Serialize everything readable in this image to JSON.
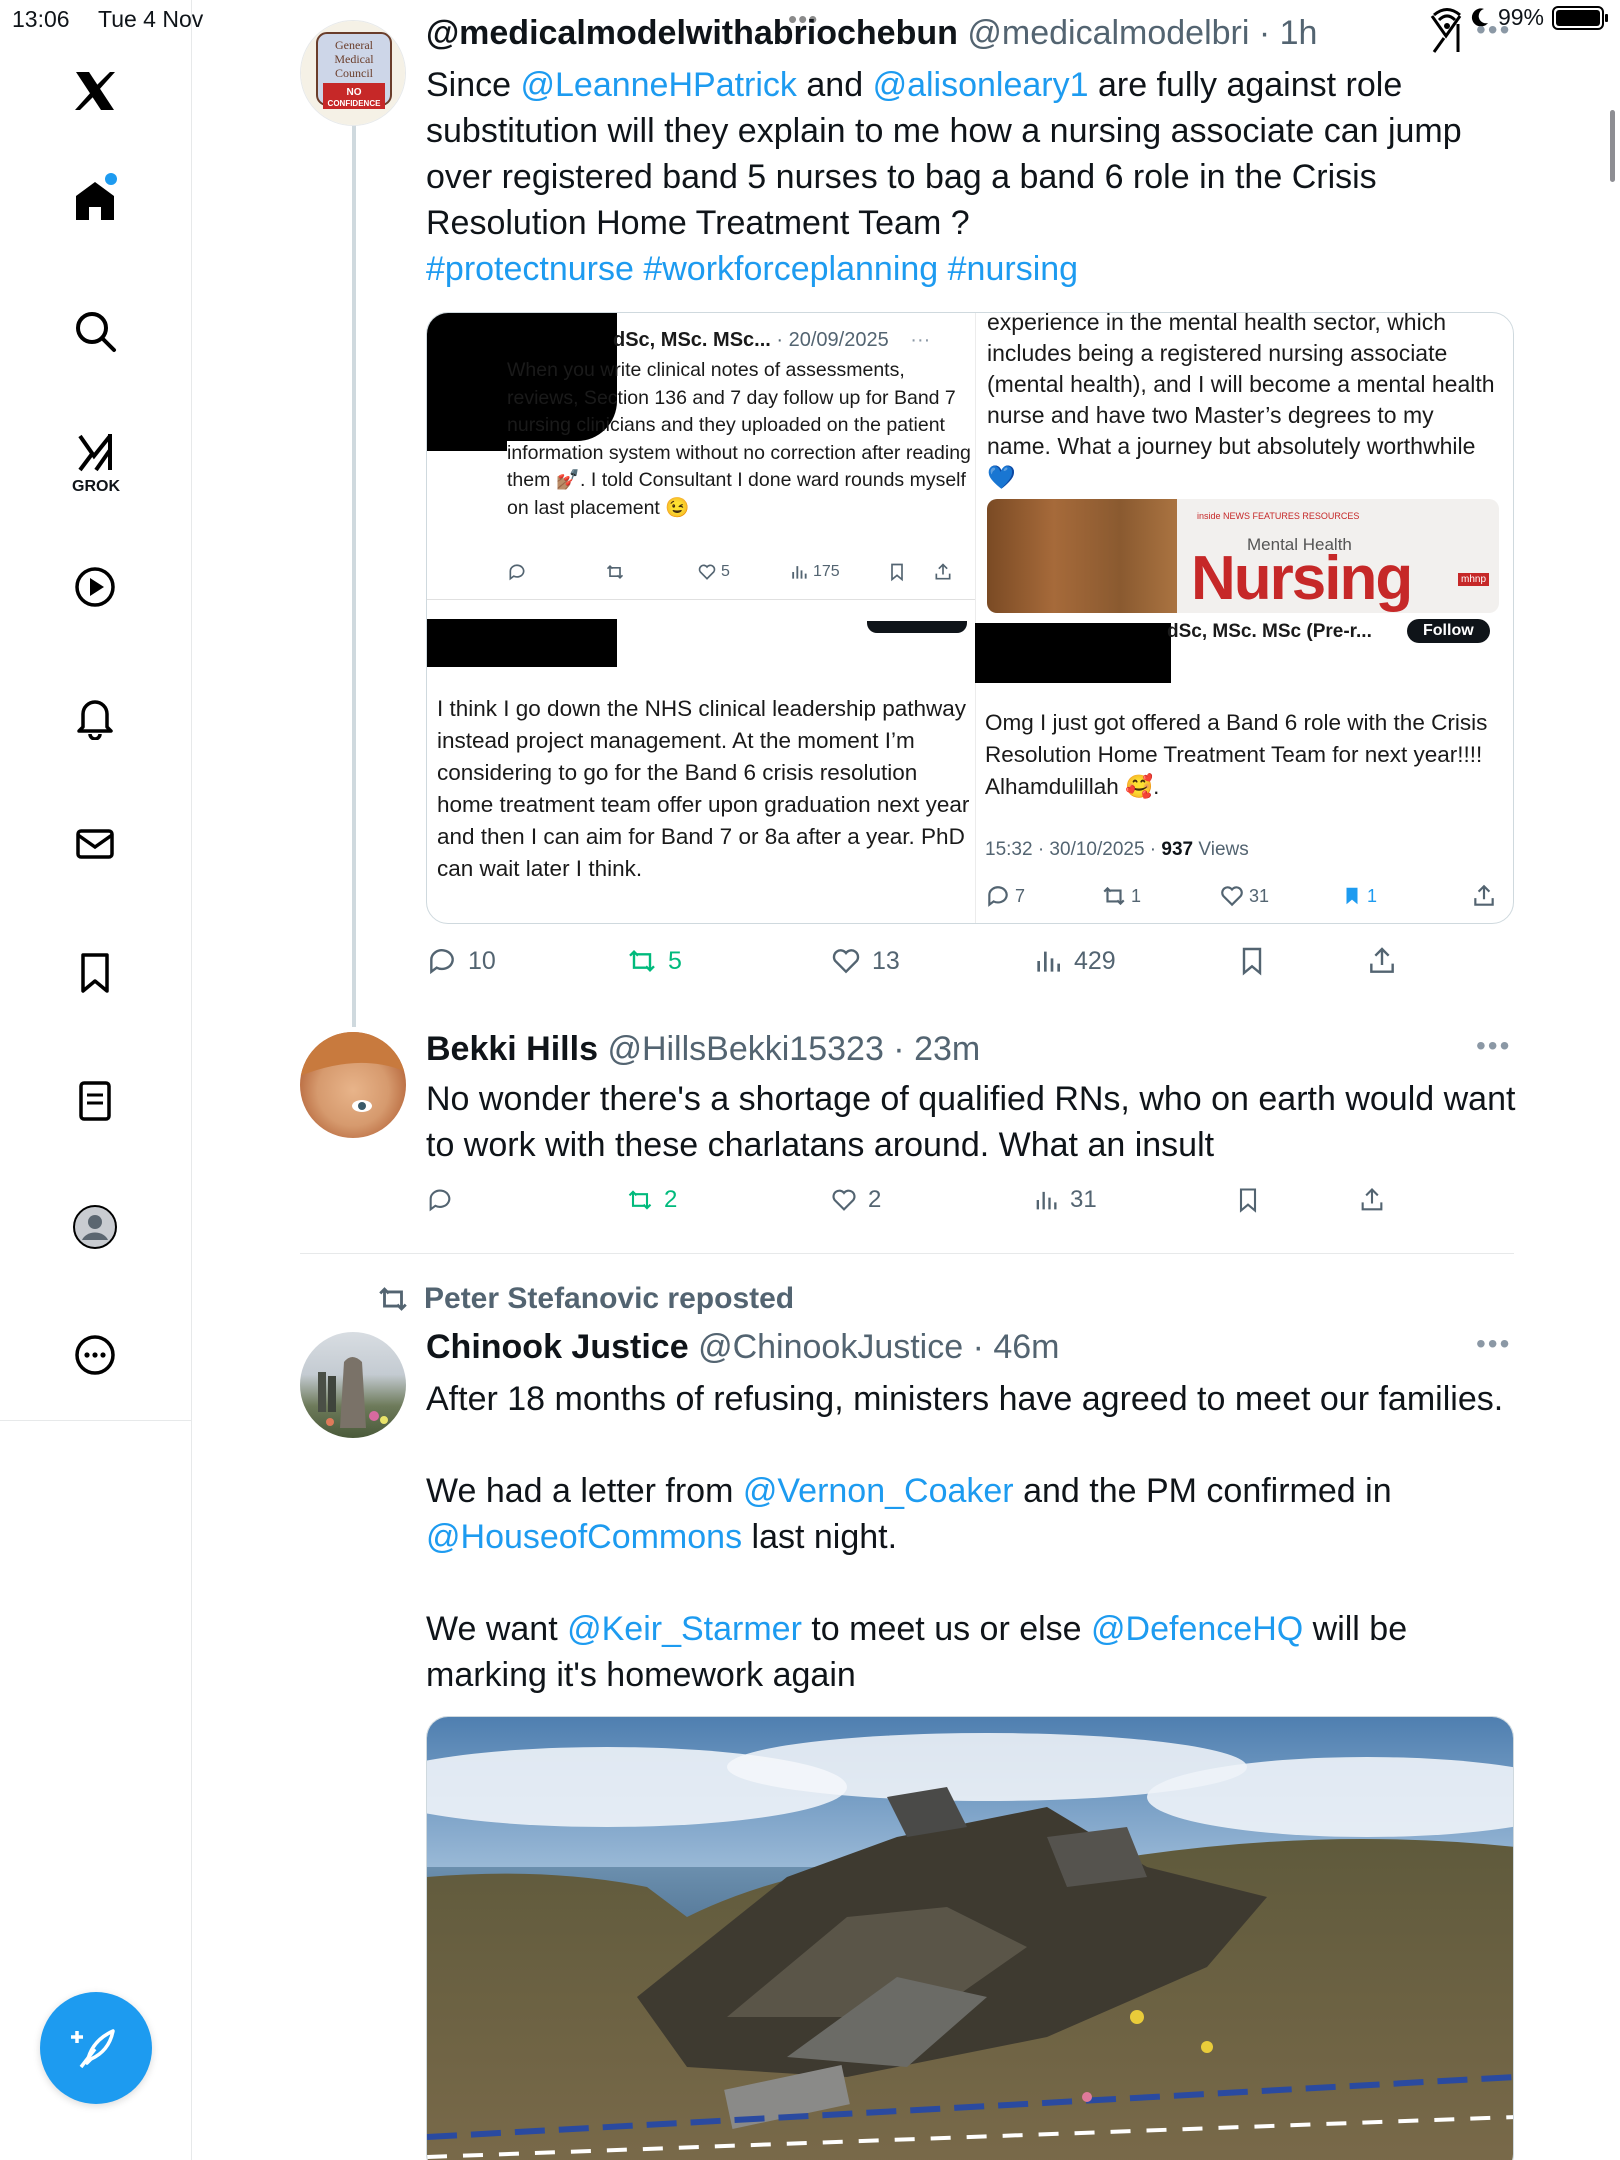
{
  "status_bar": {
    "time": "13:06",
    "date": "Tue 4 Nov",
    "battery_text": "99%",
    "battery_level": 0.99
  },
  "sidebar": {
    "items": [
      {
        "name": "x-logo",
        "label": ""
      },
      {
        "name": "home",
        "label": ""
      },
      {
        "name": "search",
        "label": ""
      },
      {
        "name": "grok",
        "label": "GROK"
      },
      {
        "name": "video",
        "label": ""
      },
      {
        "name": "notifications",
        "label": ""
      },
      {
        "name": "messages",
        "label": ""
      },
      {
        "name": "bookmarks",
        "label": ""
      },
      {
        "name": "lists",
        "label": ""
      },
      {
        "name": "profile",
        "label": ""
      },
      {
        "name": "more",
        "label": ""
      }
    ],
    "colors": {
      "accent": "#1d9bf0"
    }
  },
  "post1": {
    "display_name": "@medicalmodelwithabriochebun",
    "handle": "@medicalmodelbri",
    "time": "1h",
    "avatar_text": [
      "General",
      "Medical",
      "Council",
      "NO",
      "CONFIDENCE"
    ],
    "text_a": "Since ",
    "mention1": "@LeanneHPatrick",
    "text_b": " and ",
    "mention2": "@alisonleary1",
    "text_c": " are fully against role substitution will they explain to me how a nursing associate can jump over registered band 5 nurses to bag a band 6 role in the Crisis Resolution Home Treatment Team ?",
    "hashtags": "#protectnurse #workforceplanning #nursing",
    "stats": {
      "replies": "10",
      "reposts": "5",
      "likes": "13",
      "views": "429"
    }
  },
  "collage": {
    "q1": {
      "name_fragment": "dSc, MSc. MSc...",
      "date": "· 20/09/2025",
      "text": "When you write clinical notes of assessments, reviews, Section 136 and 7 day follow up for Band 7 nursing clinicians and they uploaded on the patient information system without no correction after reading them 💅🏽. I told Consultant I done ward rounds myself on last placement 😉",
      "likes": "5",
      "views": "175"
    },
    "q2": {
      "text": "experience in the mental health sector, which includes being a registered nursing associate (mental health), and I will become a mental health nurse and have two Master’s degrees to my name. What a journey but absolutely worthwhile 💙",
      "magazine_small": "inside  NEWS  FEATURES  RESOURCES",
      "magazine_subtitle": "Mental Health",
      "magazine_title": "Nursing",
      "magazine_badge": "mhnp"
    },
    "q3": {
      "text": "I think I go down the NHS clinical leadership pathway instead project management. At the moment I’m considering to go for the Band 6 crisis resolution home treatment team offer upon graduation next year and then I can aim for Band 7 or 8a after a year. PhD can wait later I think."
    },
    "q4": {
      "name_fragment": "dSc, MSc. MSc (Pre-r...",
      "follow": "Follow",
      "text": "Omg I just got offered a Band 6 role with the Crisis Resolution Home Treatment Team for next year!!!! Alhamdulillah 🥰.",
      "timestamp": "15:32 · 30/10/2025 · ",
      "views_count": "937",
      "views_word": " Views",
      "replies": "7",
      "reposts": "1",
      "likes": "31",
      "bookmarks": "1"
    }
  },
  "post2": {
    "display_name": "Bekki Hills",
    "handle": "@HillsBekki15323",
    "time": "23m",
    "text": "No wonder there's a shortage of qualified RNs, who on earth would want to work with these charlatans around. What an insult",
    "stats": {
      "replies": "",
      "reposts": "2",
      "likes": "2",
      "views": "31"
    }
  },
  "post3": {
    "reposted_by": "Peter Stefanovic reposted",
    "display_name": "Chinook Justice",
    "handle": "@ChinookJustice",
    "time": "46m",
    "p1": "After 18 months of refusing, ministers have agreed to meet our families.",
    "p2a": "We had a letter from ",
    "p2_mention1": "@Vernon_Coaker",
    "p2b": " and the PM confirmed in ",
    "p2_mention2": "@HouseofCommons",
    "p2c": " last night.",
    "p3a": "We want ",
    "p3_mention1": "@Keir_Starmer",
    "p3b": " to meet us or else  ",
    "p3_mention2": "@DefenceHQ",
    "p3c": " will be marking it's homework again"
  }
}
